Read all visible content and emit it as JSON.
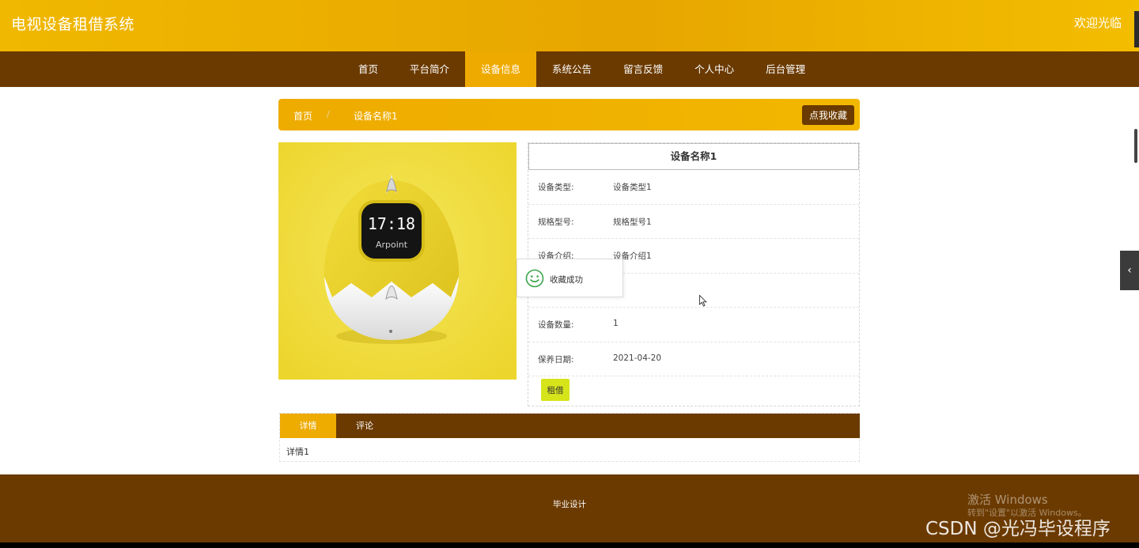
{
  "header": {
    "title": "电视设备租借系统",
    "welcome": "欢迎光临"
  },
  "nav": {
    "items": [
      {
        "label": "首页"
      },
      {
        "label": "平台简介"
      },
      {
        "label": "设备信息",
        "active": true
      },
      {
        "label": "系统公告"
      },
      {
        "label": "留言反馈"
      },
      {
        "label": "个人中心"
      },
      {
        "label": "后台管理"
      }
    ]
  },
  "breadcrumb": {
    "home": "首页",
    "separator": "/",
    "current": "设备名称1",
    "favorite_label": "点我收藏"
  },
  "product": {
    "title": "设备名称1",
    "image_text": {
      "time": "17:18",
      "brand": "Arpoint"
    },
    "fields": [
      {
        "label": "设备类型:",
        "value": "设备类型1"
      },
      {
        "label": "规格型号:",
        "value": "规格型号1"
      },
      {
        "label": "设备介绍:",
        "value": "设备介绍1"
      },
      {
        "label": "",
        "value": ""
      },
      {
        "label": "设备数量:",
        "value": "1"
      },
      {
        "label": "保养日期:",
        "value": "2021-04-20"
      }
    ],
    "rent_label": "租借"
  },
  "toast": {
    "message": "收藏成功",
    "icon": "smile-icon"
  },
  "tabs": {
    "items": [
      {
        "label": "详情",
        "active": true
      },
      {
        "label": "评论"
      }
    ],
    "content": "详情1"
  },
  "footer": {
    "text": "毕业设计"
  },
  "watermark": {
    "windows_line1": "激活 Windows",
    "windows_line2": "转到\"设置\"以激活 Windows。",
    "csdn": "CSDN @光冯毕设程序"
  },
  "colors": {
    "primary_yellow": "#efaa00",
    "dark_brown": "#6b3a00",
    "rent_button": "#d6e41a",
    "product_bg": "#f1dc3e"
  }
}
